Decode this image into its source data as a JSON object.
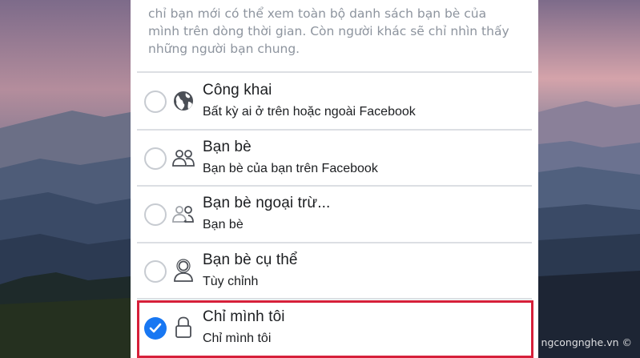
{
  "description": "chỉ bạn mới có thể xem toàn bộ danh sách bạn bè của\nmình trên dòng thời gian. Còn người khác sẽ chỉ nhìn thấy\nnhững người bạn chung.",
  "options": [
    {
      "title": "Công khai",
      "subtitle": "Bất kỳ ai ở trên hoặc ngoài Facebook",
      "icon": "globe-icon",
      "selected": false
    },
    {
      "title": "Bạn bè",
      "subtitle": "Bạn bè của bạn trên Facebook",
      "icon": "friends-icon",
      "selected": false
    },
    {
      "title": "Bạn bè ngoại trừ...",
      "subtitle": "Bạn bè",
      "icon": "friends-except-icon",
      "selected": false
    },
    {
      "title": "Bạn bè cụ thể",
      "subtitle": "Tùy chỉnh",
      "icon": "specific-friend-icon",
      "selected": false
    },
    {
      "title": "Chỉ mình tôi",
      "subtitle": "Chỉ mình tôi",
      "icon": "lock-icon",
      "selected": true
    }
  ],
  "watermark": "ngcongnghe.vn ©",
  "colors": {
    "accent": "#1877f2",
    "highlight_border": "#d6203a",
    "muted_text": "#8d949e"
  }
}
